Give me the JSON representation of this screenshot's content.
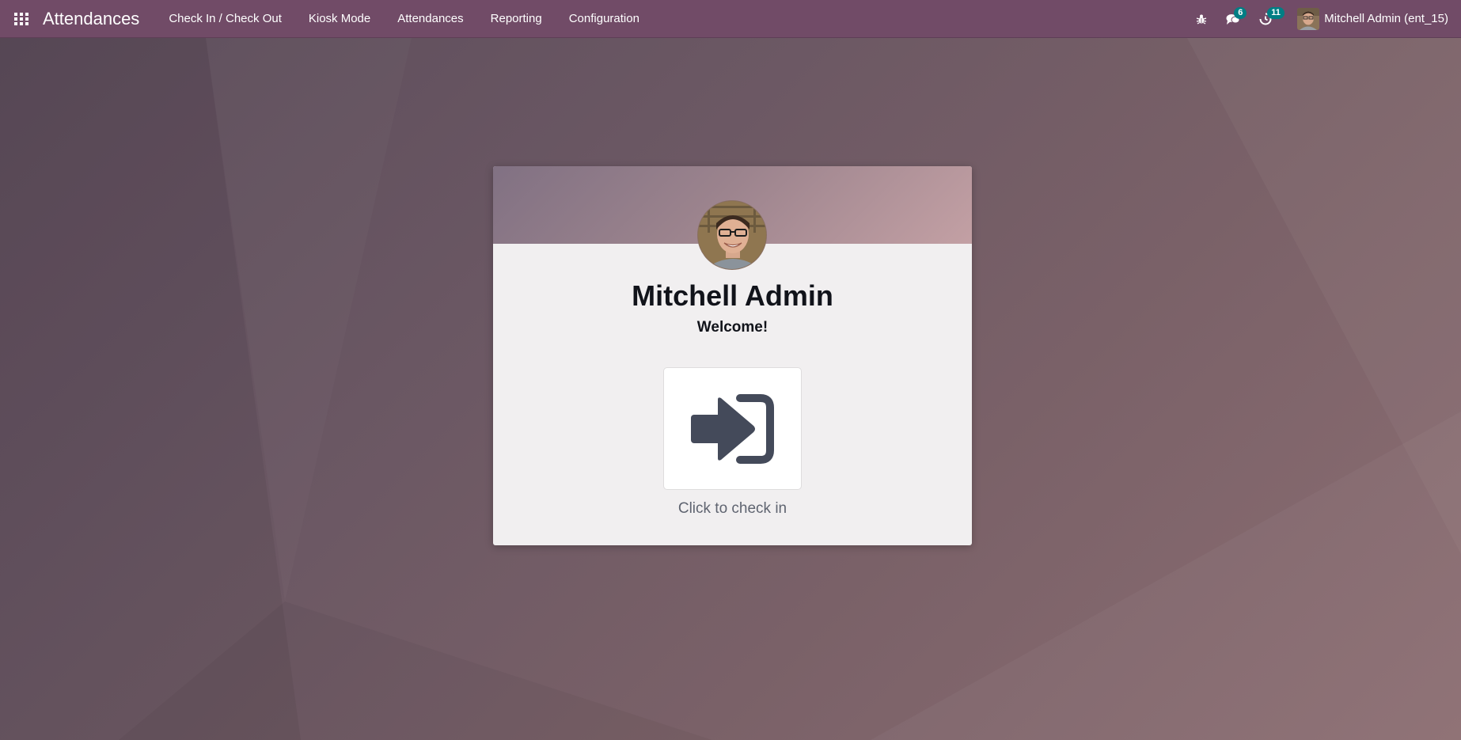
{
  "navbar": {
    "app_title": "Attendances",
    "menu": [
      {
        "label": "Check In / Check Out"
      },
      {
        "label": "Kiosk Mode"
      },
      {
        "label": "Attendances"
      },
      {
        "label": "Reporting"
      },
      {
        "label": "Configuration"
      }
    ],
    "systray": {
      "debug_icon": "bug-icon",
      "messages_icon": "chat-icon",
      "messages_count": "6",
      "activities_icon": "clock-icon",
      "activities_count": "11",
      "user_label": "Mitchell Admin (ent_15)"
    }
  },
  "card": {
    "employee_name": "Mitchell Admin",
    "greeting": "Welcome!",
    "action_icon": "sign-in-icon",
    "action_label": "Click to check in"
  },
  "colors": {
    "navbar": "#714b67",
    "badge": "#017e84",
    "card_bg": "#f1eff0",
    "icon": "#444a5a"
  }
}
